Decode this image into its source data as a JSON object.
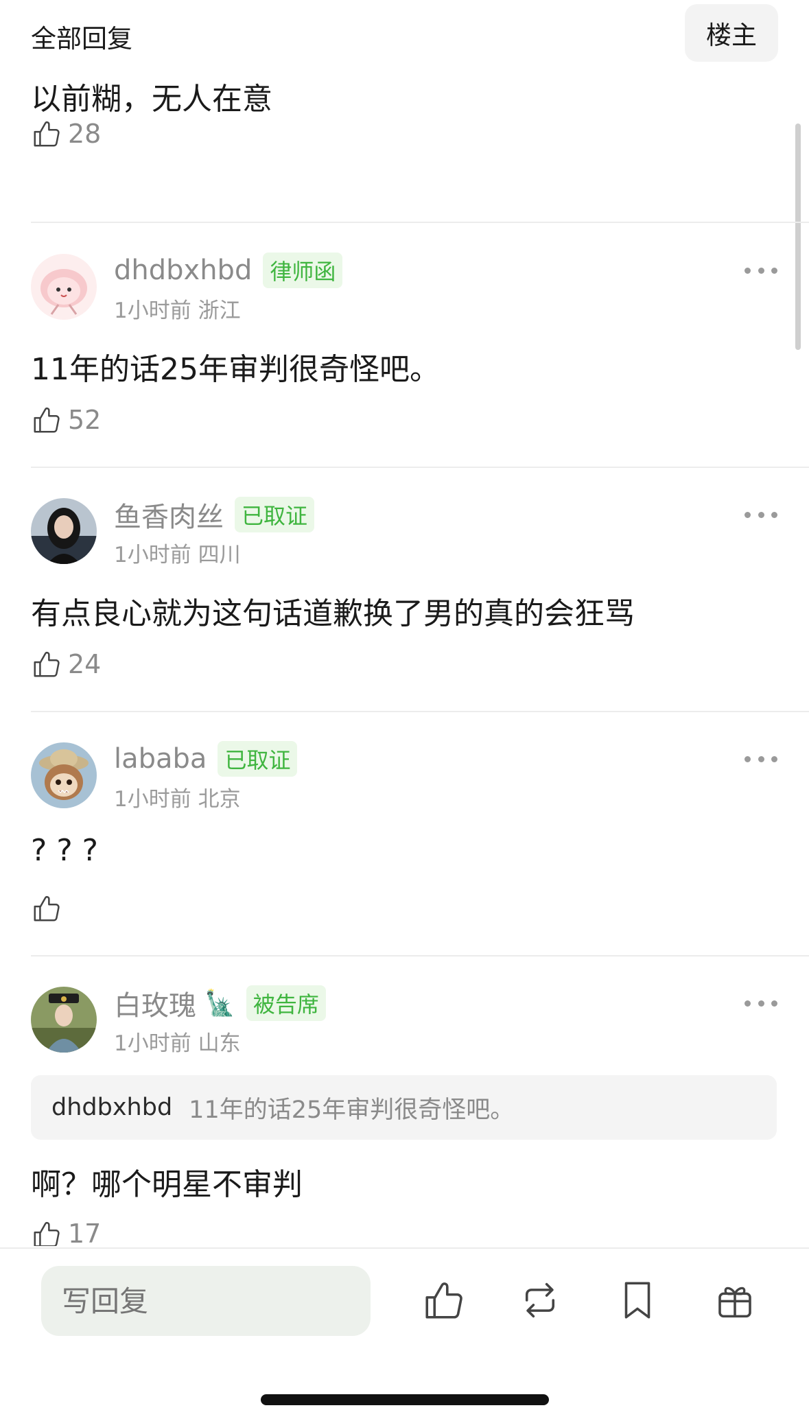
{
  "header": {
    "title": "全部回复",
    "owner_button": "楼主"
  },
  "comments": [
    {
      "content": "以前糊，无人在意",
      "likes": "28"
    },
    {
      "username": "dhdbxhbd",
      "badge": "律师函",
      "time": "1小时前",
      "location": "浙江",
      "content": "11年的话25年审判很奇怪吧。",
      "likes": "52",
      "avatar_icon": "pink-cartoon-avatar"
    },
    {
      "username": "鱼香肉丝",
      "badge": "已取证",
      "time": "1小时前",
      "location": "四川",
      "content": "有点良心就为这句话道歉换了男的真的会狂骂",
      "likes": "24",
      "avatar_icon": "woman-portrait-avatar"
    },
    {
      "username": "lababa",
      "badge": "已取证",
      "time": "1小时前",
      "location": "北京",
      "content": "? ? ?",
      "likes": "",
      "avatar_icon": "labubu-explorer-avatar"
    },
    {
      "username": "白玫瑰",
      "username_emoji": "🗽",
      "badge": "被告席",
      "time": "1小时前",
      "location": "山东",
      "quote_user": "dhdbxhbd",
      "quote_text": "11年的话25年审判很奇怪吧。",
      "content": "啊？哪个明星不审判",
      "likes": "17",
      "avatar_icon": "qing-costume-avatar"
    }
  ],
  "bottom_bar": {
    "reply_placeholder": "写回复",
    "icons": [
      "like-icon",
      "repost-icon",
      "bookmark-icon",
      "gift-icon"
    ]
  },
  "colors": {
    "badge_text": "#3fb53f",
    "badge_bg": "#ebf8e8",
    "reply_bg": "#edf1ec",
    "muted_text": "#8a8a8a"
  }
}
